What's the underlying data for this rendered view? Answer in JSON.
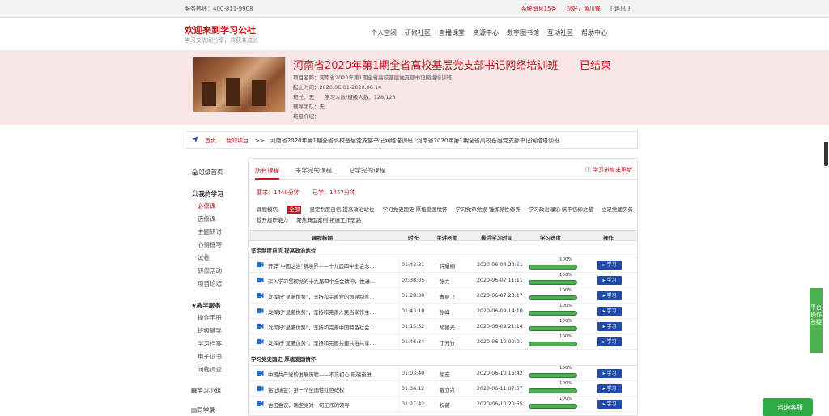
{
  "topbar": {
    "hotline": "服务热线：400-811-9908",
    "messages": "系统消息15条",
    "greeting": "您好，黄川锋",
    "logout": "[ 退出 ]"
  },
  "header": {
    "title": "欢迎来到学习公社",
    "subtitle": "学习交流同分享，共获共成长",
    "nav": [
      "个人空间",
      "研修社区",
      "直播课堂",
      "资源中心",
      "数字图书馆",
      "互动社区",
      "帮助中心"
    ]
  },
  "banner": {
    "title": "河南省2020年第1期全省高校基层党支部书记网络培训班",
    "status": "已结束",
    "info": [
      "项目名称：河南省2020年第1期全省高校基层党支部书记网络培训班",
      "起止时间：2020.06.01-2020.06.14",
      "班长：无　　学习人数/班级人数：128/128",
      "辅导团队：无",
      "班级介绍："
    ]
  },
  "breadcrumb": {
    "home": "首页",
    "project": "我的项目",
    "path": ">>　河南省2020年第1期全省高校基层党支部书记网络培训班 :河南省2020年第1期全省高校基层党支部书记网络培训班"
  },
  "sidebar": {
    "class_home": "班级首页",
    "my_study": "我的学习",
    "study_items": [
      "必修课",
      "选修课",
      "主题研讨",
      "心得撰写",
      "试卷",
      "研修活动",
      "项目论坛"
    ],
    "teaching": "教学服务",
    "teaching_items": [
      "操作手册",
      "班级辅导",
      "学习档案",
      "电子证书",
      "问卷调查"
    ],
    "group": "学习小组",
    "classmates": "同学录"
  },
  "tabs": [
    "所有课程",
    "未学完的课程",
    "已学完的课程"
  ],
  "refresh": "学习进度未更新",
  "requirement": {
    "required": "要求：1440分钟",
    "learned": "已学：1457分钟"
  },
  "filter": {
    "label": "课程模块:",
    "selected": "全部",
    "options": [
      "坚定制度自信 提高政治站位",
      "学习党史国史 厚植爱国情怀",
      "学习党章党规 锤炼党性修养",
      "学习政治理论 筑牢信仰之基",
      "立足党建实务 提升履职能力",
      "聚焦典型案例 拓展工作思路"
    ]
  },
  "table": {
    "headers": [
      "课程标题",
      "时长",
      "主讲老师",
      "最后学习时间",
      "学习进度",
      "操作"
    ],
    "groups": [
      {
        "name": "坚定制度自信 提高政治站位",
        "rows": [
          {
            "title": "开辟\"中国之治\"新境界——十九届四中全会总...",
            "duration": "01:43:31",
            "teacher": "许耀桐",
            "last": "2020-06-04 20:51",
            "progress": 1.0,
            "progress_label": "100%",
            "action": "学习"
          },
          {
            "title": "深入学习贯彻党的十九届四中全会精神，推进...",
            "duration": "02:38:05",
            "teacher": "张力",
            "last": "2020-06-07 11:11",
            "progress": 1.0,
            "progress_label": "100%",
            "action": "学习"
          },
          {
            "title": "发挥好\"显著优势\"，坚持和完善党的领导制度...",
            "duration": "01:28:30",
            "teacher": "曹丽飞",
            "last": "2020-06-07 23:17",
            "progress": 1.0,
            "progress_label": "100%",
            "action": "学习"
          },
          {
            "title": "发挥好\"显著优势\"，坚持和完善人民当家作主...",
            "duration": "01:43:10",
            "teacher": "张峰",
            "last": "2020-06-09 14:10",
            "progress": 1.0,
            "progress_label": "100%",
            "action": "学习"
          },
          {
            "title": "发挥好\"显著优势\"，坚持和完善中国特色社会...",
            "duration": "01:13:52",
            "teacher": "胡德光",
            "last": "2020-06-09 21:14",
            "progress": 1.0,
            "progress_label": "100%",
            "action": "学习"
          },
          {
            "title": "发挥好\"显著优势\"，坚持和完善共建共治共享...",
            "duration": "01:46:34",
            "teacher": "丁元竹",
            "last": "2020-06-10 00:01",
            "progress": 1.0,
            "progress_label": "100%",
            "action": "学习"
          }
        ]
      },
      {
        "name": "学习党史国史 厚植爱国情怀",
        "rows": [
          {
            "title": "中国共产党的发展历程——不忘初心 砥砺奋进",
            "duration": "01:03:40",
            "teacher": "屈宏",
            "last": "2020-06-10 16:42",
            "progress": 1.0,
            "progress_label": "100%",
            "action": "学习"
          },
          {
            "title": "铭记瑞金：第一个全国性红色政权",
            "duration": "01:36:12",
            "teacher": "戴立兴",
            "last": "2020-06-11 07:57",
            "progress": 1.0,
            "progress_label": "100%",
            "action": "学习"
          },
          {
            "title": "古田会议，确定党对一切工作的领导",
            "duration": "01:27:42",
            "teacher": "祝薇",
            "last": "2020-06-10 20:55",
            "progress": 1.0,
            "progress_label": "100%",
            "action": "学习"
          }
        ]
      }
    ]
  },
  "side_float": "平台操作答疑",
  "chat": "咨询客服",
  "colors": {
    "accent": "#c8161d",
    "progress": "#4caf50",
    "button": "#1f4aa8",
    "banner_bg": "#f9e6e7"
  }
}
